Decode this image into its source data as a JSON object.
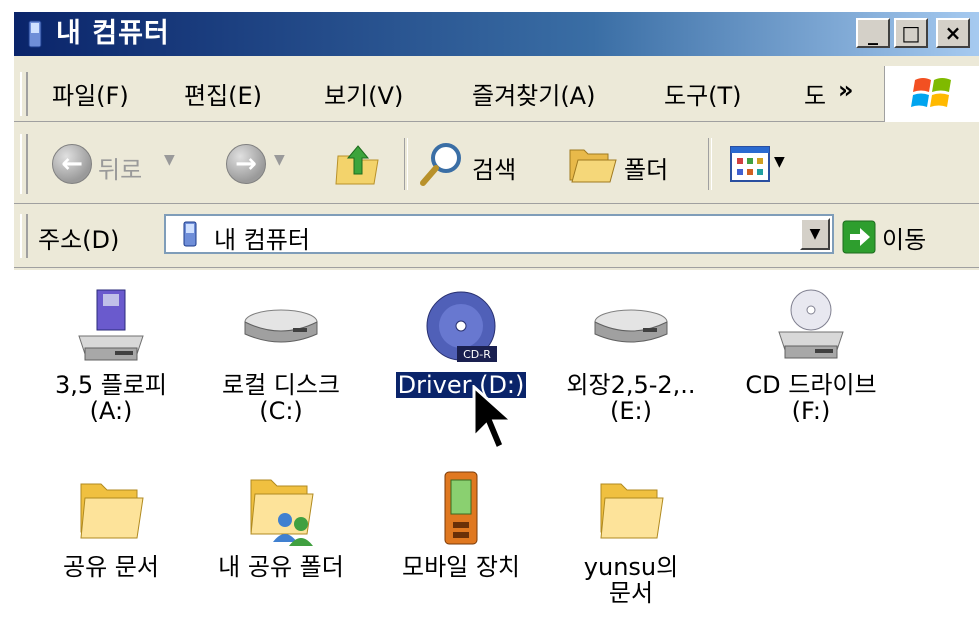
{
  "window": {
    "title": "내 컴퓨터",
    "buttons": {
      "minimize": "_",
      "maximize": "□",
      "close": "×"
    }
  },
  "menu": {
    "items": [
      {
        "label": "파일(F)"
      },
      {
        "label": "편집(E)"
      },
      {
        "label": "보기(V)"
      },
      {
        "label": "즐겨찾기(A)"
      },
      {
        "label": "도구(T)"
      },
      {
        "label": "도"
      }
    ],
    "more": "»"
  },
  "toolbar": {
    "back_label": "뒤로",
    "search_label": "검색",
    "folders_label": "폴더"
  },
  "address": {
    "label": "주소(D)",
    "value": "내 컴퓨터",
    "go_label": "이동"
  },
  "items": [
    {
      "label": "3,5 플로피\n(A:)",
      "icon": "floppy-drive-icon"
    },
    {
      "label": "로컬 디스크\n(C:)",
      "icon": "hard-disk-icon"
    },
    {
      "label": "Driver (D:)",
      "icon": "cd-r-icon",
      "selected": true,
      "badge": "CD-R"
    },
    {
      "label": "외장2,5-2,..\n(E:)",
      "icon": "hard-disk-icon"
    },
    {
      "label": "CD 드라이브\n(F:)",
      "icon": "cd-drive-icon"
    },
    {
      "label": "공유 문서",
      "icon": "folder-icon"
    },
    {
      "label": "내 공유 폴더",
      "icon": "shared-folder-icon"
    },
    {
      "label": "모바일 장치",
      "icon": "mobile-device-icon"
    },
    {
      "label": "yunsu의\n문서",
      "icon": "folder-icon"
    }
  ],
  "colors": {
    "title_start": "#0a246a",
    "selection": "#0a246a",
    "go_arrow": "#2e9e2e"
  }
}
